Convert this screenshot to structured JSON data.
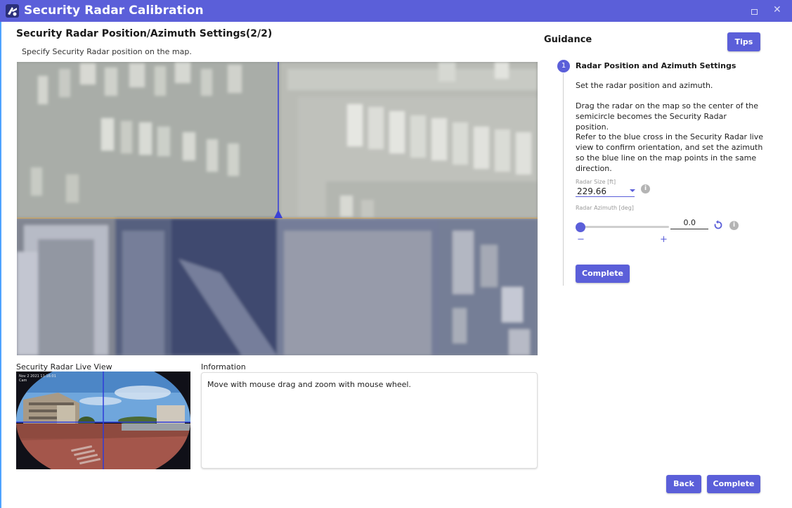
{
  "window": {
    "title": "Security Radar Calibration",
    "accent": "#5b5fd9",
    "maximize_icon": "maximize-icon",
    "close_glyph": "✕"
  },
  "page": {
    "heading": "Security Radar Position/Azimuth Settings(2/2)",
    "subheading": "Specify Security Radar position on the map."
  },
  "live_view": {
    "label": "Security Radar Live View",
    "overlay_line1": "Nov 2 2021 11:16:01",
    "overlay_line2": "Cam"
  },
  "information": {
    "label": "Information",
    "text": "Move with mouse drag and zoom with mouse wheel."
  },
  "guidance": {
    "title": "Guidance",
    "tips_label": "Tips",
    "step_number": "1",
    "step_title": "Radar Position and Azimuth Settings",
    "paragraph1": "Set the radar position and azimuth.",
    "paragraph2": "Drag the radar on the map so the center of the semicircle becomes the Security Radar position.",
    "paragraph3": "Refer to the blue cross in the Security Radar live view to confirm orientation, and set the azimuth so the blue line on the map points in the same direction.",
    "radar_size_label": "Radar Size [ft]",
    "radar_size_value": "229.66",
    "radar_azimuth_label": "Radar Azimuth [deg]",
    "radar_azimuth_value": "0.0",
    "azimuth_slider_fraction": 0.0,
    "minus_label": "−",
    "plus_label": "+",
    "info_glyph": "i",
    "complete_label": "Complete"
  },
  "footer": {
    "back_label": "Back",
    "complete_label": "Complete"
  }
}
